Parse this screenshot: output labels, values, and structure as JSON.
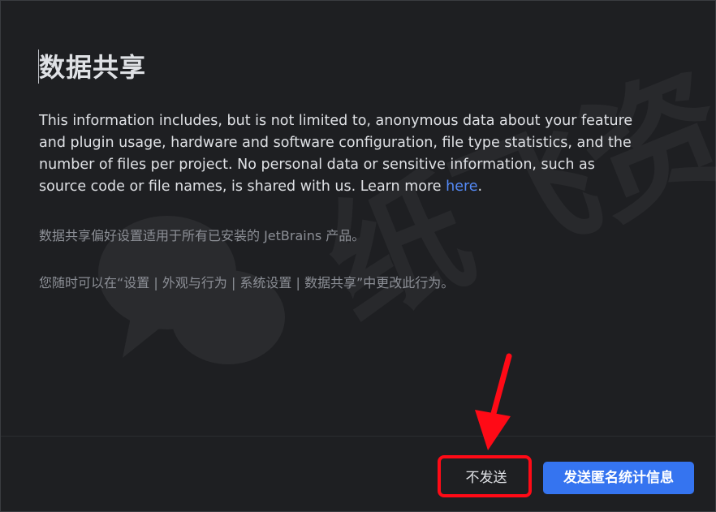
{
  "dialog": {
    "title": "数据共享",
    "description": "This information includes, but is not limited to, anonymous data about your feature and plugin usage, hardware and software configuration, file type statistics, and the number of files per project. No personal data or sensitive information, such as source code or file names, is shared with us. Learn more ",
    "link_text": "here",
    "link_suffix": ".",
    "note_products": "数据共享偏好设置适用于所有已安装的 JetBrains 产品。",
    "note_settings": "您随时可以在“设置 | 外观与行为 | 系统设置 | 数据共享”中更改此行为。"
  },
  "buttons": {
    "decline_label": "不发送",
    "accept_label": "发送匿名统计信息"
  },
  "watermark": {
    "text": "纸飞资"
  },
  "colors": {
    "background": "#1e1f22",
    "accent": "#3574f0",
    "link": "#548af7",
    "annotation": "#ff0a16"
  }
}
